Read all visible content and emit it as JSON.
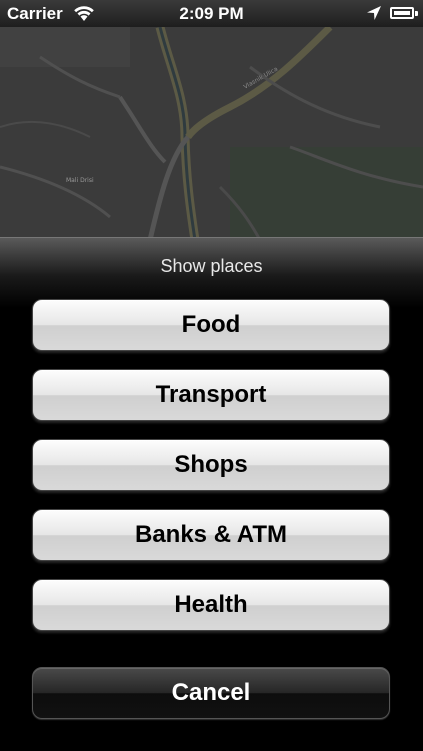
{
  "status_bar": {
    "carrier": "Carrier",
    "time": "2:09 PM"
  },
  "map": {
    "labels": [
      "Mali Drisi",
      "Vlasnik Ulica"
    ]
  },
  "sheet": {
    "title": "Show places",
    "options": [
      "Food",
      "Transport",
      "Shops",
      "Banks & ATM",
      "Health"
    ],
    "cancel_label": "Cancel"
  }
}
